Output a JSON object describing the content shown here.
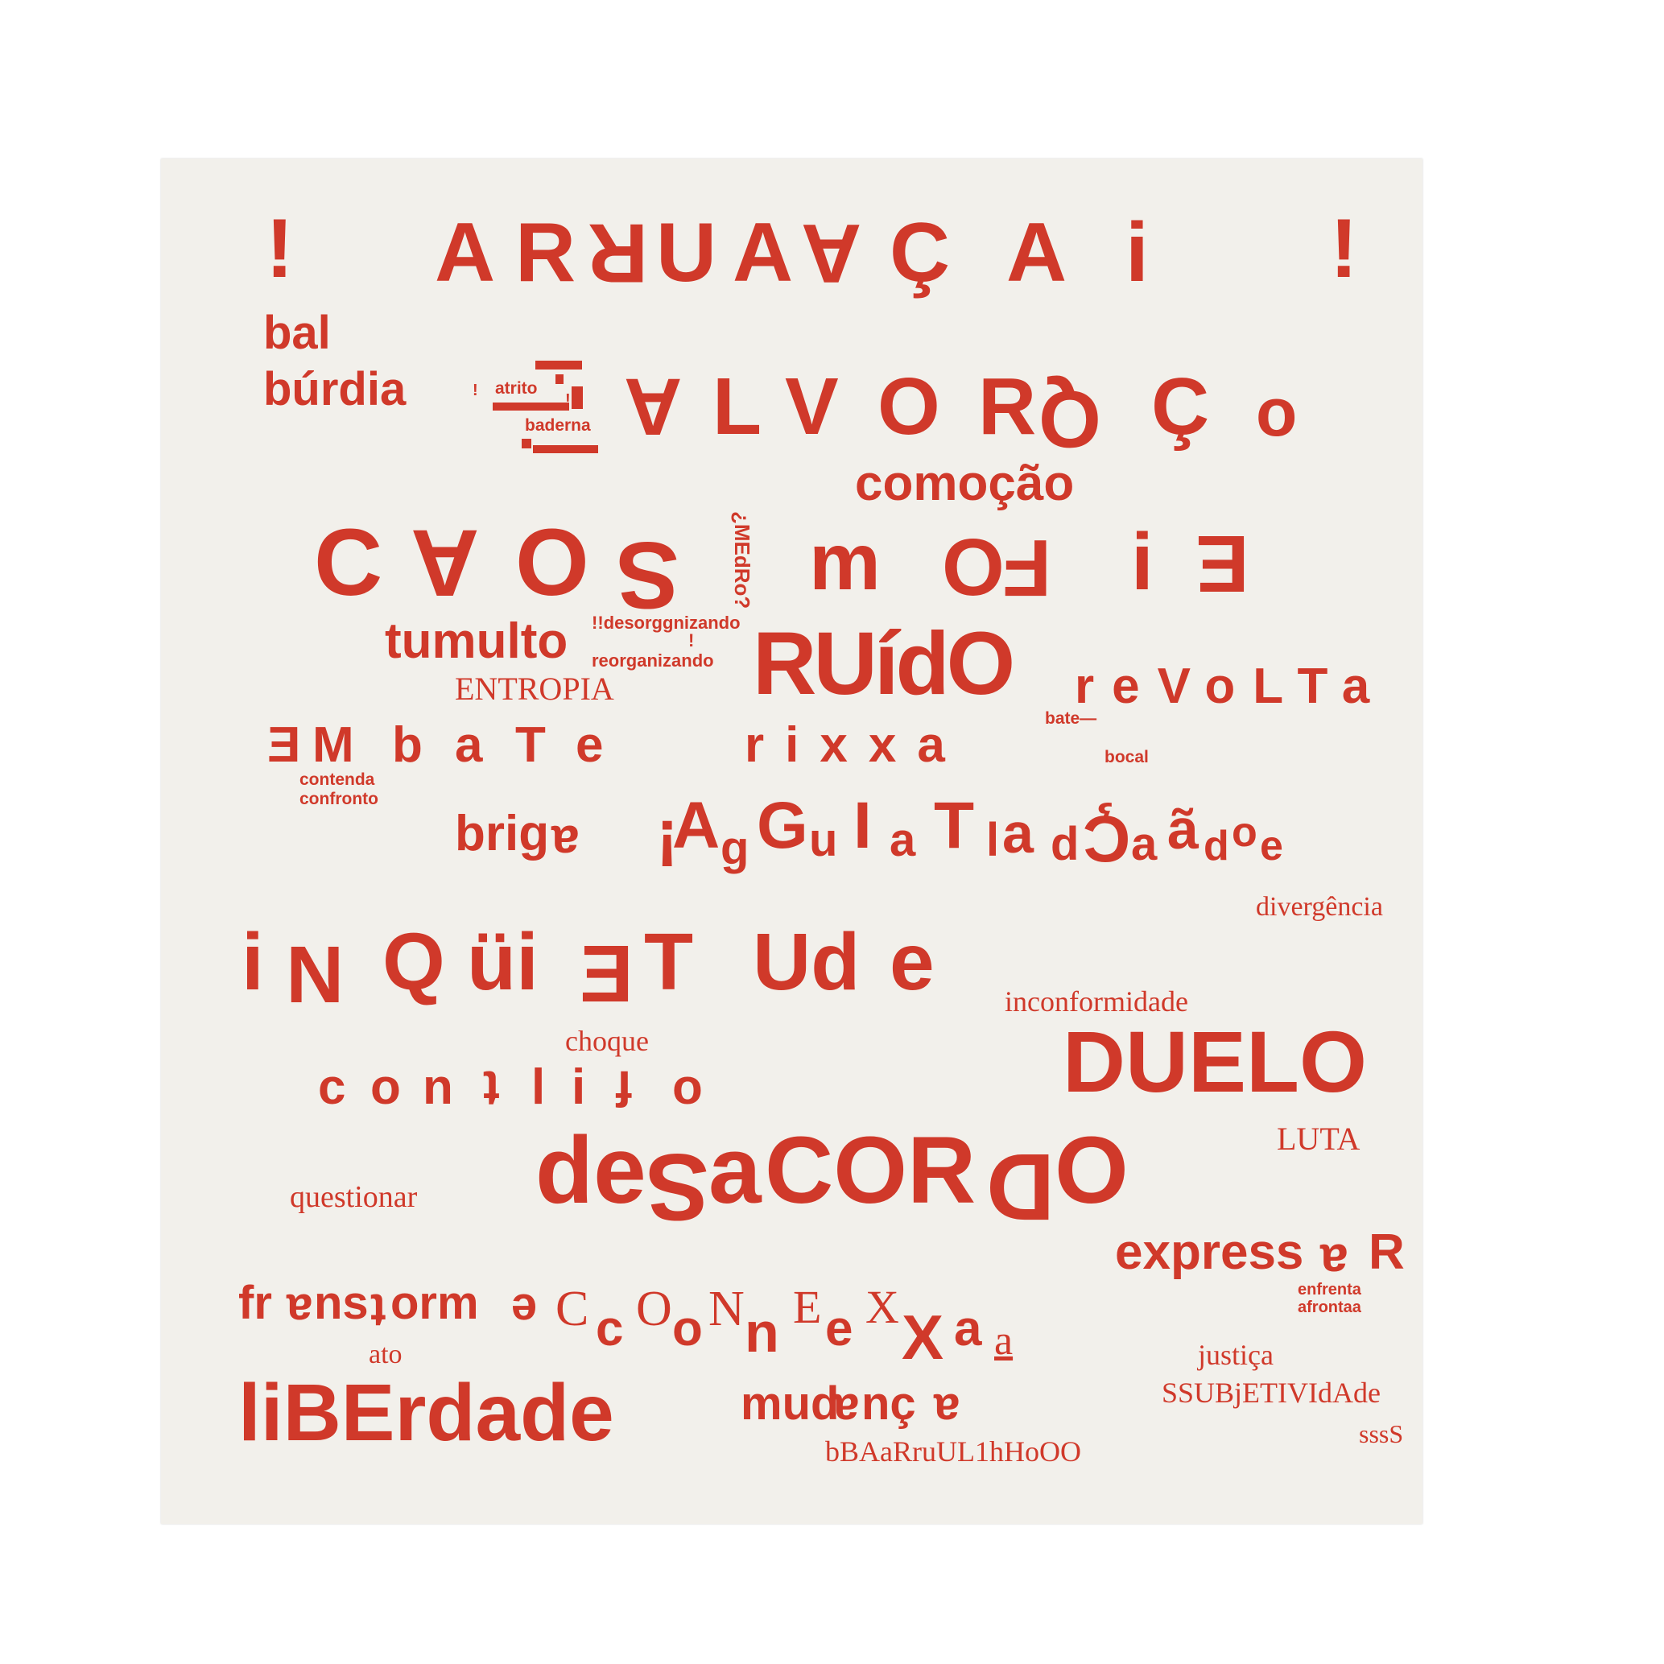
{
  "artwork": {
    "line1": [
      "¡",
      "A",
      "R",
      "R",
      "U",
      "A",
      "A",
      "Ç",
      "A",
      "i",
      "¡"
    ],
    "bal": "bal",
    "burdia": "búrdia",
    "atrito": "atrito",
    "baderna": "baderna",
    "excl_small": "!",
    "excl_small2": "!",
    "alvoroco": [
      "A",
      "L",
      "V",
      "O",
      "R",
      "Q",
      "Ç",
      "o"
    ],
    "comocao": "comoção",
    "caos": [
      "C",
      "A",
      "O",
      "S"
    ],
    "mofim": [
      "m",
      "O",
      "F",
      "i",
      "E"
    ],
    "medo": "¿MEdRo?",
    "tumulto": "tumulto",
    "desorganizando": "!!desorggnizando",
    "reorganizando": "reorganizando",
    "excl_mid": "!",
    "ruido": "RUídO",
    "revolta": "reVoLTa",
    "entropia": "ENTROPIA",
    "embate": [
      "E",
      "M",
      "b",
      "a",
      "T",
      "e"
    ],
    "rixxa": "rixxa",
    "bate": "bate—",
    "bocal": "bocal",
    "contenda": "contenda",
    "confronto": "confronto",
    "briga": "brig",
    "briga_flip": "a",
    "agulhada": [
      "¡",
      "A",
      "g",
      "G",
      "u",
      "I",
      "a",
      "T",
      "l",
      "a",
      "d",
      "Ç",
      "a",
      "ã",
      "d",
      "o",
      "e"
    ],
    "divergencia": "divergência",
    "inquietude": [
      "i",
      "N",
      "Q",
      "üi",
      "E",
      "T",
      "Ud",
      "e"
    ],
    "inconformidade": "inconformidade",
    "choque": "choque",
    "duelo": "DUELO",
    "conflito": [
      "c",
      "o",
      "n",
      "t",
      "l",
      "i",
      "f",
      "o"
    ],
    "luta": "LUTA",
    "desacordo": [
      "de",
      "S",
      "a",
      "COR",
      "D",
      "O"
    ],
    "questionar": "questionar",
    "expressar": "express",
    "expressar_flip": "a",
    "expressar_end": "R",
    "enfrenta": "enfrenta",
    "afrontaa": "afrontaa",
    "transforme": [
      "fr",
      "a",
      "ns",
      "t",
      "orm",
      "e"
    ],
    "conexao": [
      "C",
      "c",
      "O",
      "o",
      "N",
      "n",
      "E",
      "e",
      "X",
      "X",
      "a",
      "a"
    ],
    "ato": "ato",
    "justica": "justiça",
    "subjetividade": "SSUBjETIVIdAde",
    "liberdade": "liBErdade",
    "mudanca": [
      "mud",
      "a",
      "nç",
      "a"
    ],
    "ssss": "sssS",
    "barulho": "bBAaRruUL1hHoOO"
  },
  "colors": {
    "ink": "#d0392a",
    "paper": "#f2f0eb",
    "background": "#ffffff"
  }
}
